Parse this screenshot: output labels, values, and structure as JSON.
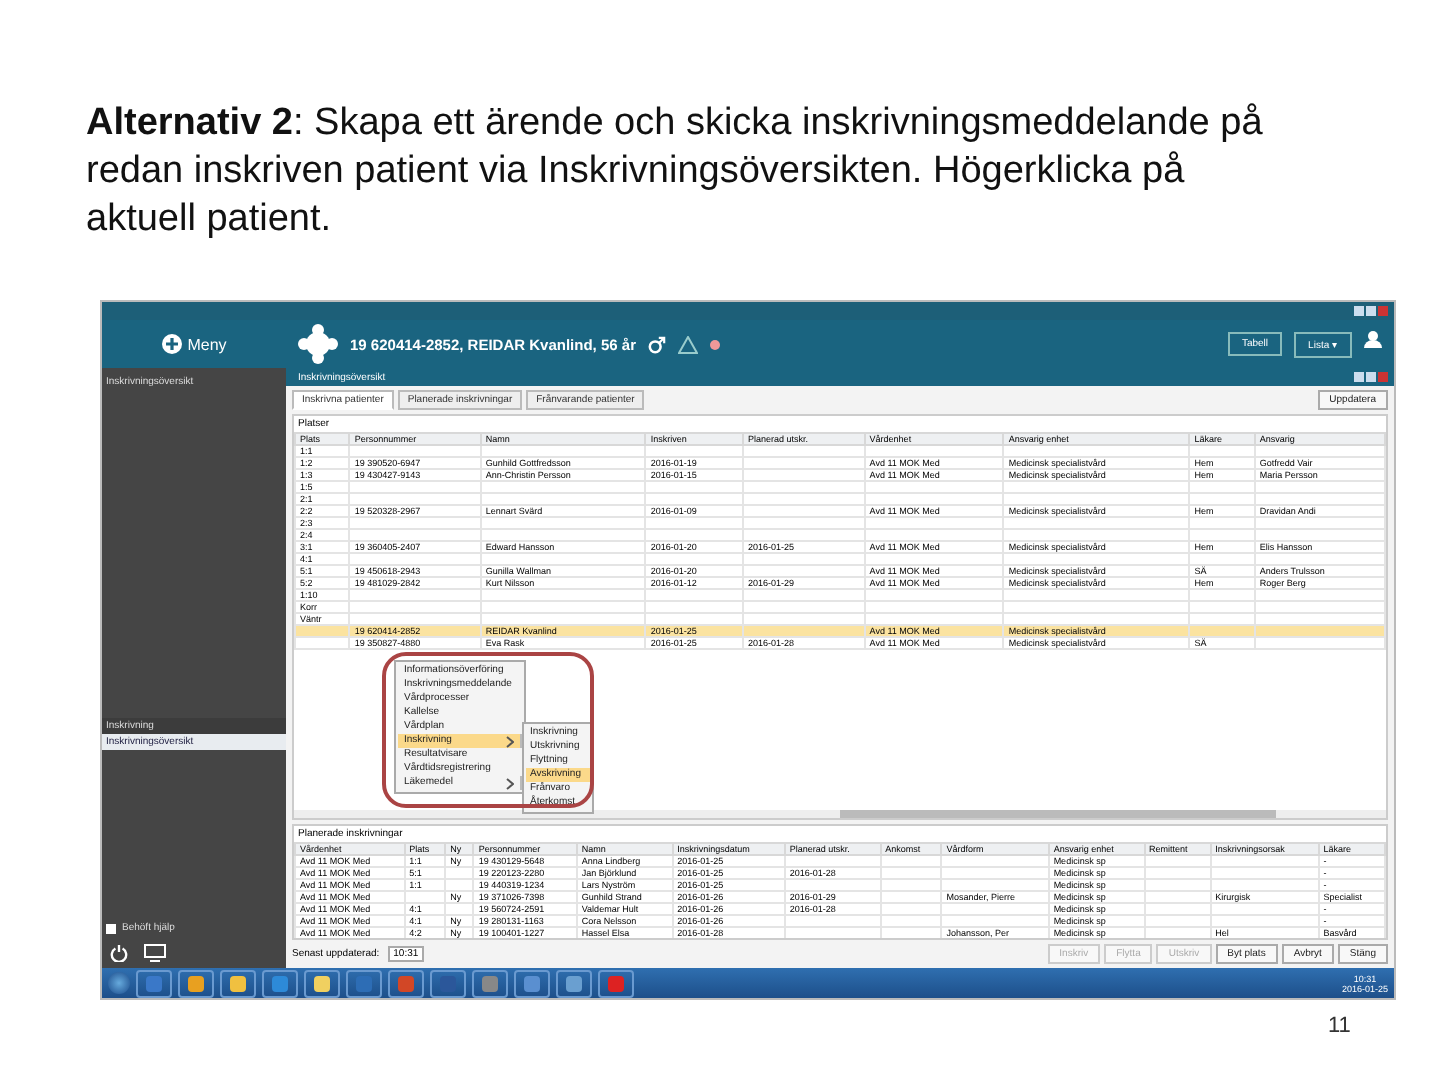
{
  "slide": {
    "text": "**Alternativ 2**: Skapa ett ärende och skicka inskrivningsmeddelande på redan inskriven patient via Inskrivningsöversikten. Högerklicka på aktuell patient.",
    "page_number": "11"
  },
  "app": {
    "menu_button": "Meny",
    "sidebar_heading": "Inskrivningsöversikt",
    "sidebar_items": [
      {
        "label": "Inskrivning",
        "selected": false
      },
      {
        "label": "Inskrivningsöversikt",
        "selected": true
      }
    ],
    "patient": "19 620414-2852, REIDAR Kvanlind, 56 år",
    "header_buttons": [
      "Tabell",
      "Lista ▾"
    ],
    "tab": "Inskrivningsöversikt",
    "subtabs": [
      {
        "label": "Inskrivna patienter",
        "selected": true
      },
      {
        "label": "Planerade inskrivningar",
        "selected": false
      },
      {
        "label": "Frånvarande patienter",
        "selected": false
      }
    ],
    "refresh_button": "Uppdatera",
    "section": "Platser",
    "columns": [
      "Plats",
      "Personnummer",
      "Namn",
      "Inskriven",
      "Planerad utskr.",
      "Vårdenhet",
      "Ansvarig enhet",
      "Läkare",
      "Ansvarig"
    ],
    "rows": [
      {
        "cells": [
          "1:1",
          "",
          "",
          "",
          "",
          "",
          "",
          "",
          ""
        ],
        "selected": false
      },
      {
        "cells": [
          "1:2",
          "19 390520-6947",
          "Gunhild Gottfredsson",
          "2016-01-19",
          "",
          "Avd 11 MOK Med",
          "Medicinsk specialistvård",
          "Hem",
          "Gotfredd Vair"
        ],
        "selected": false
      },
      {
        "cells": [
          "1:3",
          "19 430427-9143",
          "Ann-Christin Persson",
          "2016-01-15",
          "",
          "Avd 11 MOK Med",
          "Medicinsk specialistvård",
          "Hem",
          "Maria Persson"
        ],
        "selected": false
      },
      {
        "cells": [
          "1:5",
          "",
          "",
          "",
          "",
          "",
          "",
          "",
          ""
        ],
        "selected": false
      },
      {
        "cells": [
          "2:1",
          "",
          "",
          "",
          "",
          "",
          "",
          "",
          ""
        ],
        "selected": false
      },
      {
        "cells": [
          "2:2",
          "19 520328-2967",
          "Lennart Svärd",
          "2016-01-09",
          "",
          "Avd 11 MOK Med",
          "Medicinsk specialistvård",
          "Hem",
          "Dravidan Andi"
        ],
        "selected": false
      },
      {
        "cells": [
          "2:3",
          "",
          "",
          "",
          "",
          "",
          "",
          "",
          ""
        ],
        "selected": false
      },
      {
        "cells": [
          "2:4",
          "",
          "",
          "",
          "",
          "",
          "",
          "",
          ""
        ],
        "selected": false
      },
      {
        "cells": [
          "3:1",
          "19 360405-2407",
          "Edward Hansson",
          "2016-01-20",
          "2016-01-25",
          "Avd 11 MOK Med",
          "Medicinsk specialistvård",
          "Hem",
          "Elis Hansson"
        ],
        "selected": false
      },
      {
        "cells": [
          "4:1",
          "",
          "",
          "",
          "",
          "",
          "",
          "",
          ""
        ],
        "selected": false
      },
      {
        "cells": [
          "5:1",
          "19 450618-2943",
          "Gunilla Wallman",
          "2016-01-20",
          "",
          "Avd 11 MOK Med",
          "Medicinsk specialistvård",
          "SÄ",
          "Anders Trulsson"
        ],
        "selected": false
      },
      {
        "cells": [
          "5:2",
          "19 481029-2842",
          "Kurt Nilsson",
          "2016-01-12",
          "2016-01-29",
          "Avd 11 MOK Med",
          "Medicinsk specialistvård",
          "Hem",
          "Roger Berg"
        ],
        "selected": false
      },
      {
        "cells": [
          "1:10",
          "",
          "",
          "",
          "",
          "",
          "",
          "",
          ""
        ],
        "selected": false
      },
      {
        "cells": [
          "Korr",
          "",
          "",
          "",
          "",
          "",
          "",
          "",
          ""
        ],
        "selected": false
      },
      {
        "cells": [
          "Väntr",
          "",
          "",
          "",
          "",
          "",
          "",
          "",
          ""
        ],
        "selected": false
      },
      {
        "cells": [
          "",
          "19 620414-2852",
          "REIDAR Kvanlind",
          "2016-01-25",
          "",
          "Avd 11 MOK Med",
          "Medicinsk specialistvård",
          "",
          ""
        ],
        "selected": true
      },
      {
        "cells": [
          "",
          "19 350827-4880",
          "Eva Rask",
          "2016-01-25",
          "2016-01-28",
          "Avd 11 MOK Med",
          "Medicinsk specialistvård",
          "SÄ",
          ""
        ],
        "selected": false
      }
    ],
    "context_menu": [
      {
        "label": "Informationsöverföring",
        "selected": false,
        "submenu": false
      },
      {
        "label": "Inskrivningsmeddelande",
        "selected": false,
        "submenu": false
      },
      {
        "label": "Vårdprocesser",
        "selected": false,
        "submenu": false
      },
      {
        "label": "Kallelse",
        "selected": false,
        "submenu": false
      },
      {
        "label": "Vårdplan",
        "selected": false,
        "submenu": false
      },
      {
        "label": "Inskrivning",
        "selected": true,
        "submenu": true
      },
      {
        "label": "Resultatvisare",
        "selected": false,
        "submenu": false
      },
      {
        "label": "Vårdtidsregistrering",
        "selected": false,
        "submenu": false
      },
      {
        "label": "Läkemedel",
        "selected": false,
        "submenu": true
      }
    ],
    "submenu": [
      {
        "label": "Inskrivning",
        "selected": false
      },
      {
        "label": "Utskrivning",
        "selected": false
      },
      {
        "label": "Flyttning",
        "selected": false
      },
      {
        "label": "Avskrivning",
        "selected": true
      },
      {
        "label": "Frånvaro",
        "selected": false
      },
      {
        "label": "Återkomst",
        "selected": false
      }
    ],
    "lower_section": "Planerade inskrivningar",
    "lower_columns": [
      "Vårdenhet",
      "Plats",
      "Ny",
      "Personnummer",
      "Namn",
      "Inskrivningsdatum",
      "Planerad utskr.",
      "Ankomst",
      "Vårdform",
      "Ansvarig enhet",
      "Remittent",
      "Inskrivningsorsak",
      "Läkare"
    ],
    "lower_rows": [
      {
        "cells": [
          "Avd 11 MOK Med",
          "1:1",
          "Ny",
          "19 430129-5648",
          "Anna Lindberg",
          "2016-01-25",
          "",
          "",
          "",
          "Medicinsk sp",
          "",
          "",
          "-"
        ]
      },
      {
        "cells": [
          "Avd 11 MOK Med",
          "5:1",
          "",
          "19 220123-2280",
          "Jan Björklund",
          "2016-01-25",
          "2016-01-28",
          "",
          "",
          "Medicinsk sp",
          "",
          "",
          "-"
        ]
      },
      {
        "cells": [
          "Avd 11 MOK Med",
          "1:1",
          "",
          "19 440319-1234",
          "Lars Nyström",
          "2016-01-25",
          "",
          "",
          "",
          "Medicinsk sp",
          "",
          "",
          "-"
        ]
      },
      {
        "cells": [
          "Avd 11 MOK Med",
          "",
          "Ny",
          "19 371026-7398",
          "Gunhild Strand",
          "2016-01-26",
          "2016-01-29",
          "",
          "Mosander, Pierre",
          "Medicinsk sp",
          "",
          "Kirurgisk",
          "Specialist"
        ]
      },
      {
        "cells": [
          "Avd 11 MOK Med",
          "4:1",
          "",
          "19 560724-2591",
          "Valdemar Hult",
          "2016-01-26",
          "2016-01-28",
          "",
          "",
          "Medicinsk sp",
          "",
          "",
          "-"
        ]
      },
      {
        "cells": [
          "Avd 11 MOK Med",
          "4:1",
          "Ny",
          "19 280131-1163",
          "Cora Nelsson",
          "2016-01-26",
          "",
          "",
          "",
          "Medicinsk sp",
          "",
          "",
          "-"
        ]
      },
      {
        "cells": [
          "Avd 11 MOK Med",
          "4:2",
          "Ny",
          "19 100401-1227",
          "Hassel Elsa",
          "2016-01-28",
          "",
          "",
          "Johansson, Per",
          "Medicinsk sp",
          "",
          "Hel",
          "Basvård"
        ]
      }
    ],
    "sidebar_checkbox": {
      "label": "Behöft hjälp",
      "checked": false
    },
    "time_label": "Senast uppdaterad:",
    "time_value": "10:31",
    "bottom_buttons": [
      {
        "label": "Inskriv",
        "disabled": true
      },
      {
        "label": "Flytta",
        "disabled": true
      },
      {
        "label": "Utskriv",
        "disabled": true
      },
      {
        "label": "Byt plats",
        "disabled": false
      },
      {
        "label": "Avbryt",
        "disabled": false
      },
      {
        "label": "Stäng",
        "disabled": false
      }
    ],
    "clock": [
      "10:31",
      "2016-01-25"
    ]
  }
}
